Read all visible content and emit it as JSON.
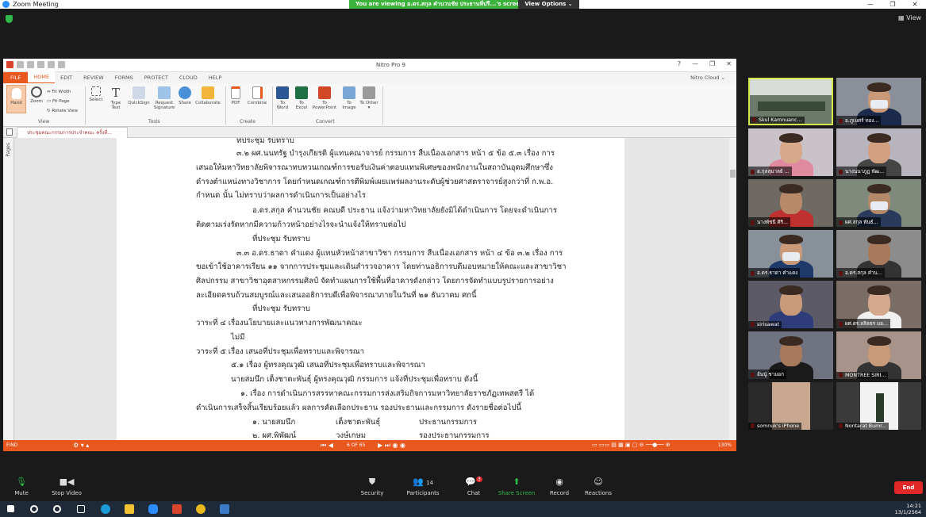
{
  "zoom": {
    "window_title": "Zoom Meeting",
    "banner_text": "You are viewing อ.ดร.สกุล คำนวนชัย ประธานที่ปรึ...'s screen",
    "view_options": "View Options ⌄",
    "view_label": "View",
    "win_min": "—",
    "win_max": "❐",
    "win_close": "✕"
  },
  "nitro": {
    "title": "Nitro Pro 9",
    "cloud": "Nitro Cloud ⌄",
    "win_ctl": [
      "?",
      "—",
      "❐",
      "✕"
    ],
    "tabs": [
      "FILE",
      "HOME",
      "EDIT",
      "REVIEW",
      "FORMS",
      "PROTECT",
      "CLOUD",
      "HELP"
    ],
    "ribbon": {
      "hand": "Hand",
      "zoom": "Zoom",
      "fit_width": "Fit Width",
      "fit_page": "Fit Page",
      "rotate_view": "Rotate View",
      "select": "Select",
      "type_text": "Type Text",
      "quicksign": "QuickSign",
      "request_signature": "Request Signature",
      "share": "Share",
      "collaborate": "Collaborate",
      "pdf": "PDF",
      "combine": "Combine",
      "to_word": "To Word",
      "to_excel": "To Excel",
      "to_powerpoint": "To PowerPoint",
      "to_image": "To Image",
      "to_other": "To Other ▾",
      "grp_view": "View",
      "grp_tools": "Tools",
      "grp_create": "Create",
      "grp_convert": "Convert"
    },
    "doc_tab": "ประชุมคณะกรรมการประจำคณะ ครั้งที่...",
    "pages_label": "Pages",
    "status": {
      "find": "FIND",
      "page": "6 OF 65",
      "zoom": "130%"
    },
    "doc_lines": [
      "ที่ประชุม รับทราบ",
      "๓.๒ ผศ.นนทรัฐ บำรุงเกียรติ ผู้แทนคณาจารย์ กรรมการ สืบเนื่องเอกสาร หน้า ๕ ข้อ ๕.๓ เรื่อง การ",
      "เสนอให้มหาวิทยาลัยพิจารณาทบทวนเกณฑ์การขอรับเงินค่าตอบแทนพิเศษของพนักงานในสถาบันอุดมศึกษาซึ่ง",
      "ดำรงตำแหน่งทางวิชาการ โดยกำหนดเกณฑ์การตีพิมพ์เผยแพร่ผลงานระดับผู้ช่วยศาสตราจารย์สูงกว่าที่ ก.พ.อ.",
      "กำหนด นั้น ไม่ทราบว่าผลการดำเนินการเป็นอย่างไร",
      "อ.ดร.สกุล คำนวนชัย คณบดี ประธาน แจ้งว่ามหาวิทยาลัยยังมิได้ดำเนินการ โดยจะดำเนินการ",
      "ติดตามเร่งรัดหากมีความก้าวหน้าอย่างไรจะนำแจ้งให้ทราบต่อไป",
      "ที่ประชุม รับทราบ",
      "๓.๓ อ.ดร.ธาดา คำแดง ผู้แทนหัวหน้าสาขาวิชา กรรมการ สืบเนื่องเอกสาร หน้า ๔ ข้อ ๓.๒ เรื่อง การ",
      "ขอเข้าใช้อาคารเรียน ๑๑ จากการประชุมและเดินสำรวจอาคาร โดยท่านอธิการบดีมอบหมายให้คณะและสาขาวิชา",
      "ศิลปกรรม สาขาวิชาอุตสาหกรรมศิลป์ จัดทำแผนการใช้พื้นที่อาคารดังกล่าว โดยการจัดทำแบบรูปรายการอย่าง",
      "ละเอียดครบถ้วนสมบูรณ์และเสนออธิการบดีเพื่อพิจารณาภายในวันที่ ๒๑ ธันวาคม ศกนี้",
      "ที่ประชุม รับทราบ",
      "วาระที่ ๔ เรื่องนโยบายและแนวทางการพัฒนาคณะ",
      "ไม่มี",
      "วาระที่ ๕ เรื่อง เสนอที่ประชุมเพื่อทราบและพิจารณา",
      "๕.๑ เรื่อง ผู้ทรงคุณวุฒิ เสนอที่ประชุมเพื่อทราบและพิจารณา",
      "นายสมนึก เต็งชาตะพันธุ์ ผู้ทรงคุณวุฒิ กรรมการ แจ้งที่ประชุมเพื่อทราบ ดังนี้",
      "๑. เรื่อง การดำเนินการสรรหาคณะกรรมการส่งเสริมกิจการมหาวิทยาลัยราชภัฏเทพสตรี ได้",
      "ดำเนินการเสร็จสิ้นเรียบร้อยแล้ว ผลการคัดเลือกประธาน รองประธานและกรรมการ ดังรายชื่อต่อไปนี้",
      "๑. นายสมนึก",
      "เต็งชาตะพันธุ์",
      "ประธานกรรมการ",
      "๒. ผศ.พิพัฒน์",
      "วงษ์เกษม",
      "รองประธานกรรมการ"
    ]
  },
  "participants": [
    "Skul Kamnuanc...",
    "อ.ภูเบศร์ ทอง...",
    "อ.กุลสุมาลย์ ...",
    "นางนนาภูฏ พัฒ...",
    "นางพัชนี ศิริ...",
    "ผศ.สกุล พันธ์...",
    "อ.ดร.ธาดา คำแดง",
    "อ.ดร.สกุล คำน...",
    "sirisawat",
    "ผศ.ดร.ลลิลธร มอ...",
    "อ้นนู๋ ชามอก",
    "MONTREE SIRI...",
    "somnuk's iPhone",
    "Nontarat Bumr..."
  ],
  "toolbar": {
    "mute": "Mute",
    "stop_video": "Stop Video",
    "security": "Security",
    "participants": "Participants",
    "participants_count": "14",
    "chat": "Chat",
    "chat_badge": "3",
    "share_screen": "Share Screen",
    "record": "Record",
    "reactions": "Reactions",
    "end": "End"
  },
  "taskbar": {
    "time": "14:21",
    "date": "13/1/2564"
  }
}
